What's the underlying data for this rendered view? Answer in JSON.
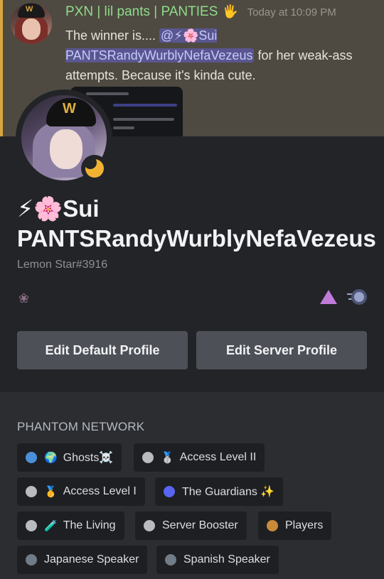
{
  "message": {
    "author": "PXN | lil pants | PANTIES",
    "author_emoji": "🖐",
    "timestamp": "Today at 10:09 PM",
    "text_prefix": "The winner is.... ",
    "mention": "@⚡🌸Sui PANTSRandyWurblyNefaVezeus",
    "text_suffix": " for her weak-ass attempts. Because it's kinda cute.",
    "accent_color": "#d9a53f"
  },
  "profile": {
    "display_name": "⚡🌸Sui PANTSRandyWurblyNefaVezeus",
    "username": "Lemon Star#3916",
    "status": "idle",
    "avatar_logo": "W",
    "badges": [
      "nitro-flower-icon",
      "hypesquad-triangle-icon",
      "server-boost-orb-icon"
    ],
    "buttons": {
      "edit_default": "Edit Default Profile",
      "edit_server": "Edit Server Profile"
    }
  },
  "roles": {
    "section_title": "PHANTOM NETWORK",
    "items": [
      {
        "name": "Ghosts☠️",
        "color": "#4a90d9",
        "icon": "🌍"
      },
      {
        "name": "Access Level II",
        "color": "#b9bbbe",
        "icon": "🥈"
      },
      {
        "name": "Access Level I",
        "color": "#b9bbbe",
        "icon": "🥇"
      },
      {
        "name": "The Guardians ✨",
        "color": "#5865f2",
        "icon": ""
      },
      {
        "name": "The Living",
        "color": "#b9bbbe",
        "icon": "🧪"
      },
      {
        "name": "Server Booster",
        "color": "#b9bbbe",
        "icon": ""
      },
      {
        "name": "Players",
        "color": "#c98a3a",
        "icon": ""
      },
      {
        "name": "Japanese Speaker",
        "color": "#707c87",
        "icon": ""
      },
      {
        "name": "Spanish Speaker",
        "color": "#707c87",
        "icon": ""
      }
    ]
  }
}
